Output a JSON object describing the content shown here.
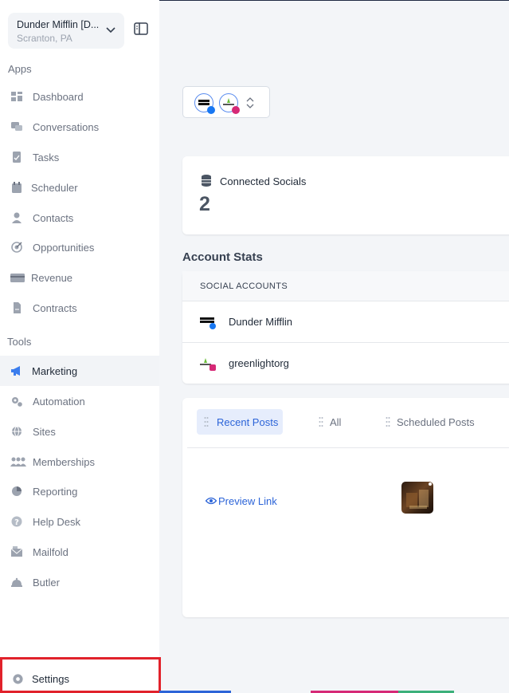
{
  "org": {
    "name": "Dunder Mifflin [D...",
    "location": "Scranton, PA"
  },
  "sections": {
    "apps": "Apps",
    "tools": "Tools"
  },
  "nav_apps": [
    {
      "label": "Dashboard",
      "icon": "dashboard-icon"
    },
    {
      "label": "Conversations",
      "icon": "chat-icon"
    },
    {
      "label": "Tasks",
      "icon": "tasks-icon"
    },
    {
      "label": "Scheduler",
      "icon": "calendar-icon"
    },
    {
      "label": "Contacts",
      "icon": "person-icon"
    },
    {
      "label": "Opportunities",
      "icon": "target-icon"
    },
    {
      "label": "Revenue",
      "icon": "credit-card-icon"
    },
    {
      "label": "Contracts",
      "icon": "document-icon"
    }
  ],
  "nav_tools": [
    {
      "label": "Marketing",
      "icon": "megaphone-icon",
      "active": true
    },
    {
      "label": "Automation",
      "icon": "gears-icon"
    },
    {
      "label": "Sites",
      "icon": "globe-icon"
    },
    {
      "label": "Memberships",
      "icon": "members-icon"
    },
    {
      "label": "Reporting",
      "icon": "pie-chart-icon"
    },
    {
      "label": "Help Desk",
      "icon": "help-icon"
    },
    {
      "label": "Mailfold",
      "icon": "mail-icon"
    },
    {
      "label": "Butler",
      "icon": "bell-icon"
    }
  ],
  "settings": {
    "label": "Settings",
    "icon": "gear-icon"
  },
  "connected": {
    "title": "Connected Socials",
    "count": "2"
  },
  "stats": {
    "heading": "Account Stats",
    "column": "SOCIAL ACCOUNTS",
    "accounts": [
      {
        "name": "Dunder Mifflin",
        "network": "facebook"
      },
      {
        "name": "greenlightorg",
        "network": "instagram"
      }
    ]
  },
  "posts": {
    "tabs": [
      "Recent Posts",
      "All",
      "Scheduled Posts"
    ],
    "active_tab": "Recent Posts",
    "preview_link": "Preview Link"
  },
  "colors": {
    "accent": "#2c64d8",
    "highlight_box": "#e1222b",
    "facebook": "#1877f2",
    "instagram": "#d62976"
  }
}
